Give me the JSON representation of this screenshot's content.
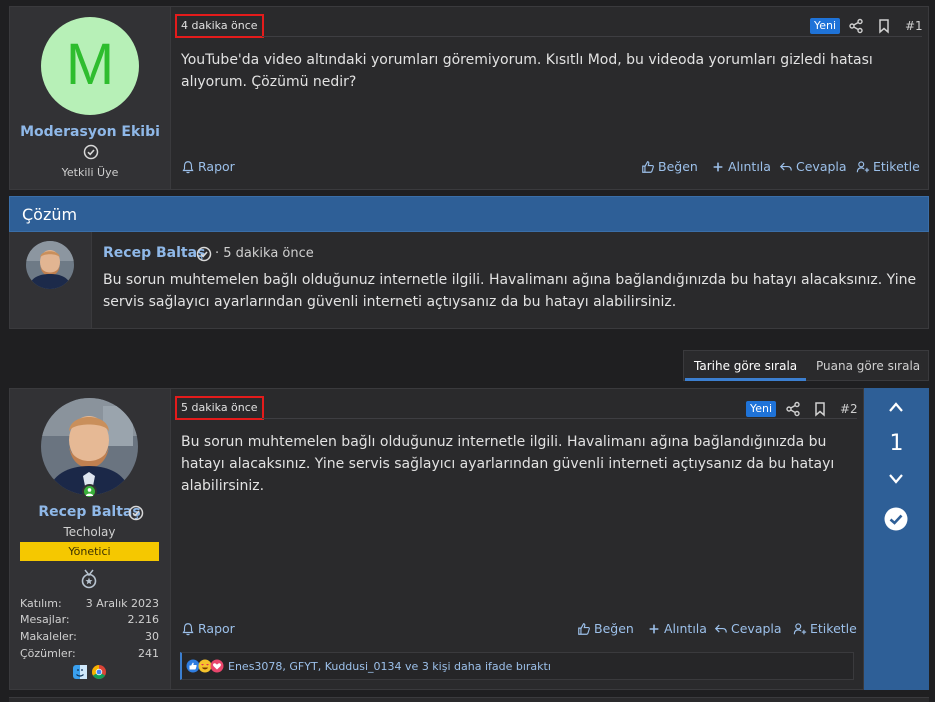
{
  "post1": {
    "username": "Moderasyon Ekibi",
    "avatar_letter": "M",
    "user_title": "Yetkili Üye",
    "time": "4 dakika önce",
    "new_badge": "Yeni",
    "post_number": "#1",
    "text": "YouTube'da video altındaki yorumları göremiyorum. Kısıtlı Mod, bu videoda yorumları gizledi hatası alıyorum. Çözümü nedir?",
    "actions": {
      "report": "Rapor",
      "like": "Beğen",
      "quote": "Alıntıla",
      "reply": "Cevapla",
      "tag": "Etiketle"
    }
  },
  "solution": {
    "title": "Çözüm",
    "username": "Recep Baltaş",
    "time": "· 5 dakika önce",
    "text": "Bu sorun muhtemelen bağlı olduğunuz internetle ilgili. Havalimanı ağına bağlandığınızda bu hatayı alacaksınız. Yine servis sağlayıcı ayarlarından güvenli interneti açtıysanız da bu hatayı alabilirsiniz."
  },
  "sort_tabs": {
    "by_date": "Tarihe göre sırala",
    "by_score": "Puana göre sırala"
  },
  "post2": {
    "username": "Recep Baltaş",
    "user_title": "Techolay",
    "role": "Yönetici",
    "stats": [
      {
        "label": "Katılım:",
        "value": "3 Aralık 2023"
      },
      {
        "label": "Mesajlar:",
        "value": "2.216"
      },
      {
        "label": "Makaleler:",
        "value": "30"
      },
      {
        "label": "Çözümler:",
        "value": "241"
      }
    ],
    "time": "5 dakika önce",
    "new_badge": "Yeni",
    "post_number": "#2",
    "text": "Bu sorun muhtemelen bağlı olduğunuz internetle ilgili. Havalimanı ağına bağlandığınızda bu hatayı alacaksınız. Yine servis sağlayıcı ayarlarından güvenli interneti açtıysanız da bu hatayı alabilirsiniz.",
    "actions": {
      "report": "Rapor",
      "like": "Beğen",
      "quote": "Alıntıla",
      "reply": "Cevapla",
      "tag": "Etiketle"
    },
    "reactions_text": "Enes3078, GFYT, Kuddusi_0134 ve 3 kişi daha ifade bıraktı",
    "vote_score": "1"
  },
  "colors": {
    "accent_blue": "#2e5f97",
    "link": "#9cc0ea",
    "username": "#8fb8e8",
    "new_badge": "#1f73d8",
    "role_badge": "#f5c800",
    "highlight_red": "#e41b1b"
  }
}
